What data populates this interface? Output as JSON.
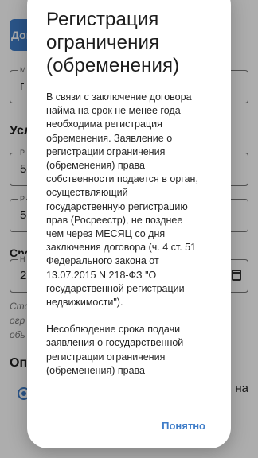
{
  "background": {
    "top_button_label": "Дог",
    "field_1": {
      "legend": "М",
      "value": "г"
    },
    "section_heading": "Усл",
    "field_2": {
      "legend": "Р",
      "value": "5"
    },
    "field_3": {
      "legend": "Р",
      "value": "5"
    },
    "date_heading": "Сро",
    "field_4": {
      "legend": "Н",
      "value": "2"
    },
    "note_lines": [
      "Сто",
      "огр",
      "обь"
    ],
    "payment_heading": "Опл",
    "radio_right_text": "на"
  },
  "dialog": {
    "title": "Регистрация ограничения (обременения)",
    "paragraph_1": "В связи с заключение договора\nнайма на срок не менее года\nнеобходима регистрация\nобременения. Заявление о\nрегистрации ограничения\n(обременения) права\nсобственности подается в орган,\nосуществляющий\nгосударственную регистрацию\nправ (Росреестр), не позднее\nчем через МЕСЯЦ со дня\nзаключения договора (ч. 4 ст. 51\nФедерального закона от\n13.07.2015 N 218-ФЗ \"О\nгосударственной регистрации\nнедвижимости\").",
    "paragraph_2": "Несоблюдение срока подачи\nзаявления о государственной\nрегистрации ограничения\n(обременения) права",
    "ok_button_label": "Понятно"
  },
  "colors": {
    "accent": "#3f7dc9",
    "scrim": "rgba(0,0,0,0.32)"
  }
}
